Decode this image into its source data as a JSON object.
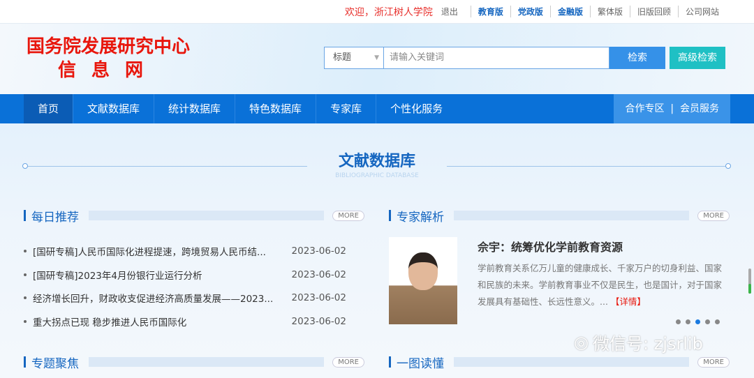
{
  "topbar": {
    "welcome": "欢迎，浙江树人学院",
    "logout": "退出",
    "links": [
      "教育版",
      "党政版",
      "金融版",
      "繁体版",
      "旧版回顾",
      "公司网站"
    ]
  },
  "logo": {
    "line1": "国务院发展研究中心",
    "line2": "信息网"
  },
  "search": {
    "field": "标题",
    "placeholder": "请输入关键词",
    "search_label": "检索",
    "advanced_label": "高级检索"
  },
  "nav": {
    "items": [
      "首页",
      "文献数据库",
      "统计数据库",
      "特色数据库",
      "专家库",
      "个性化服务"
    ],
    "right": "合作专区  |  会员服务"
  },
  "banner": {
    "title": "文献数据库",
    "subtitle": "BIBLIOGRAPHIC DATABASE"
  },
  "daily": {
    "title": "每日推荐",
    "more": "MORE",
    "items": [
      {
        "title": "[国研专稿]人民币国际化进程提速，跨境贸易人民币结...",
        "date": "2023-06-02"
      },
      {
        "title": "[国研专稿]2023年4月份银行业运行分析",
        "date": "2023-06-02"
      },
      {
        "title": "经济增长回升，财政收支促进经济高质量发展——2023...",
        "date": "2023-06-02"
      },
      {
        "title": "重大拐点已现 稳步推进人民币国际化",
        "date": "2023-06-02"
      }
    ]
  },
  "expert": {
    "title": "专家解析",
    "more": "MORE",
    "headline": "佘宇：统筹优化学前教育资源",
    "body": "学前教育关系亿万儿童的健康成长、千家万户的切身利益、国家和民族的未来。学前教育事业不仅是民生，也是国计，对于国家发展具有基础性、长远性意义。...",
    "detail": "【详情】",
    "slides": 5,
    "active_slide": 2
  },
  "topics": {
    "title": "专题聚焦",
    "more": "MORE"
  },
  "chart_read": {
    "title": "一图读懂",
    "more": "MORE"
  },
  "watermark": "微信号: zjsrlib"
}
